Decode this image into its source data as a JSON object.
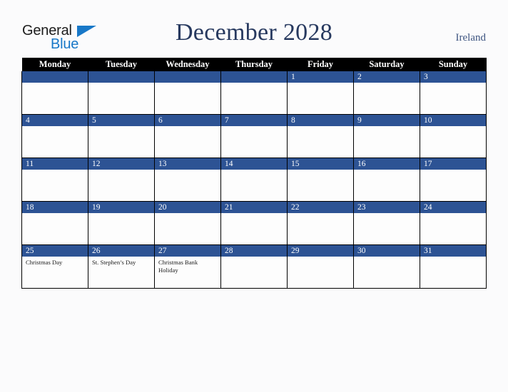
{
  "brand": {
    "name_part1": "General",
    "name_part2": "Blue",
    "triangle_icon": "blue-triangle-icon",
    "accent_color": "#1878c8"
  },
  "header": {
    "title": "December 2028",
    "country": "Ireland",
    "title_color": "#27395f"
  },
  "calendar": {
    "month": "December",
    "year": "2028",
    "weekday_headers": [
      "Monday",
      "Tuesday",
      "Wednesday",
      "Thursday",
      "Friday",
      "Saturday",
      "Sunday"
    ],
    "header_bg": "#000000",
    "daynum_band_color": "#2d5394",
    "cell_bg": "#fdfdfd",
    "border_color": "#000000",
    "weeks": [
      [
        {
          "day": "",
          "events": []
        },
        {
          "day": "",
          "events": []
        },
        {
          "day": "",
          "events": []
        },
        {
          "day": "",
          "events": []
        },
        {
          "day": "1",
          "events": []
        },
        {
          "day": "2",
          "events": []
        },
        {
          "day": "3",
          "events": []
        }
      ],
      [
        {
          "day": "4",
          "events": []
        },
        {
          "day": "5",
          "events": []
        },
        {
          "day": "6",
          "events": []
        },
        {
          "day": "7",
          "events": []
        },
        {
          "day": "8",
          "events": []
        },
        {
          "day": "9",
          "events": []
        },
        {
          "day": "10",
          "events": []
        }
      ],
      [
        {
          "day": "11",
          "events": []
        },
        {
          "day": "12",
          "events": []
        },
        {
          "day": "13",
          "events": []
        },
        {
          "day": "14",
          "events": []
        },
        {
          "day": "15",
          "events": []
        },
        {
          "day": "16",
          "events": []
        },
        {
          "day": "17",
          "events": []
        }
      ],
      [
        {
          "day": "18",
          "events": []
        },
        {
          "day": "19",
          "events": []
        },
        {
          "day": "20",
          "events": []
        },
        {
          "day": "21",
          "events": []
        },
        {
          "day": "22",
          "events": []
        },
        {
          "day": "23",
          "events": []
        },
        {
          "day": "24",
          "events": []
        }
      ],
      [
        {
          "day": "25",
          "events": [
            "Christmas Day"
          ]
        },
        {
          "day": "26",
          "events": [
            "St. Stephen’s Day"
          ]
        },
        {
          "day": "27",
          "events": [
            "Christmas Bank Holiday"
          ]
        },
        {
          "day": "28",
          "events": []
        },
        {
          "day": "29",
          "events": []
        },
        {
          "day": "30",
          "events": []
        },
        {
          "day": "31",
          "events": []
        }
      ]
    ]
  }
}
